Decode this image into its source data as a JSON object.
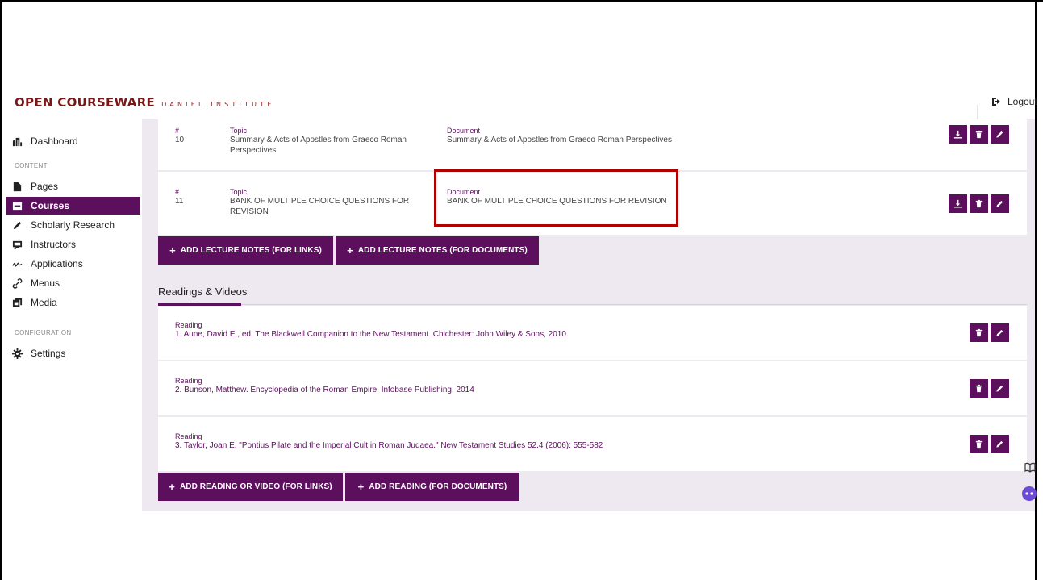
{
  "header": {
    "brand_main": "OPEN COURSEWARE",
    "brand_sub": "DANIEL INSTITUTE",
    "logout_label": "Logout"
  },
  "sidebar": {
    "dashboard": "Dashboard",
    "section_content": "CONTENT",
    "section_configuration": "CONFIGURATION",
    "items": [
      {
        "label": "Pages",
        "icon": "file-icon"
      },
      {
        "label": "Courses",
        "icon": "book-icon"
      },
      {
        "label": "Scholarly Research",
        "icon": "pen-icon"
      },
      {
        "label": "Instructors",
        "icon": "chalkboard-icon"
      },
      {
        "label": "Applications",
        "icon": "signature-icon"
      },
      {
        "label": "Menus",
        "icon": "link-icon"
      },
      {
        "label": "Media",
        "icon": "media-icon"
      }
    ],
    "settings": "Settings"
  },
  "lecture_notes": [
    {
      "num_label": "#",
      "num": "10",
      "topic_label": "Topic",
      "topic": "Summary & Acts of Apostles from Graeco Roman Perspectives",
      "doc_label": "Document",
      "doc": "Summary & Acts of Apostles from Graeco Roman Perspectives"
    },
    {
      "num_label": "#",
      "num": "11",
      "topic_label": "Topic",
      "topic": "BANK OF MULTIPLE CHOICE QUESTIONS FOR REVISION",
      "doc_label": "Document",
      "doc": "BANK OF MULTIPLE CHOICE QUESTIONS FOR REVISION"
    }
  ],
  "buttons": {
    "add_notes_links": "ADD LECTURE NOTES (FOR LINKS)",
    "add_notes_docs": "ADD LECTURE NOTES (FOR DOCUMENTS)",
    "add_reading_links": "ADD READING OR VIDEO (FOR LINKS)",
    "add_reading_docs": "ADD READING (FOR DOCUMENTS)",
    "plus": "+"
  },
  "readings_section_title": "Readings & Videos",
  "readings": [
    {
      "label": "Reading",
      "text": "1. Aune, David E., ed. The Blackwell Companion to the New Testament. Chichester: John Wiley & Sons, 2010."
    },
    {
      "label": "Reading",
      "text": "2. Bunson, Matthew. Encyclopedia of the Roman Empire. Infobase Publishing, 2014"
    },
    {
      "label": "Reading",
      "text": "3. Taylor, Joan E. \"Pontius Pilate and the Imperial Cult in Roman Judaea.\" New Testament Studies 52.4 (2006): 555-582"
    }
  ],
  "colors": {
    "accent": "#5b0f5c",
    "brand": "#7a1818",
    "highlight": "#b00000",
    "content_bg": "#eee9f1"
  }
}
